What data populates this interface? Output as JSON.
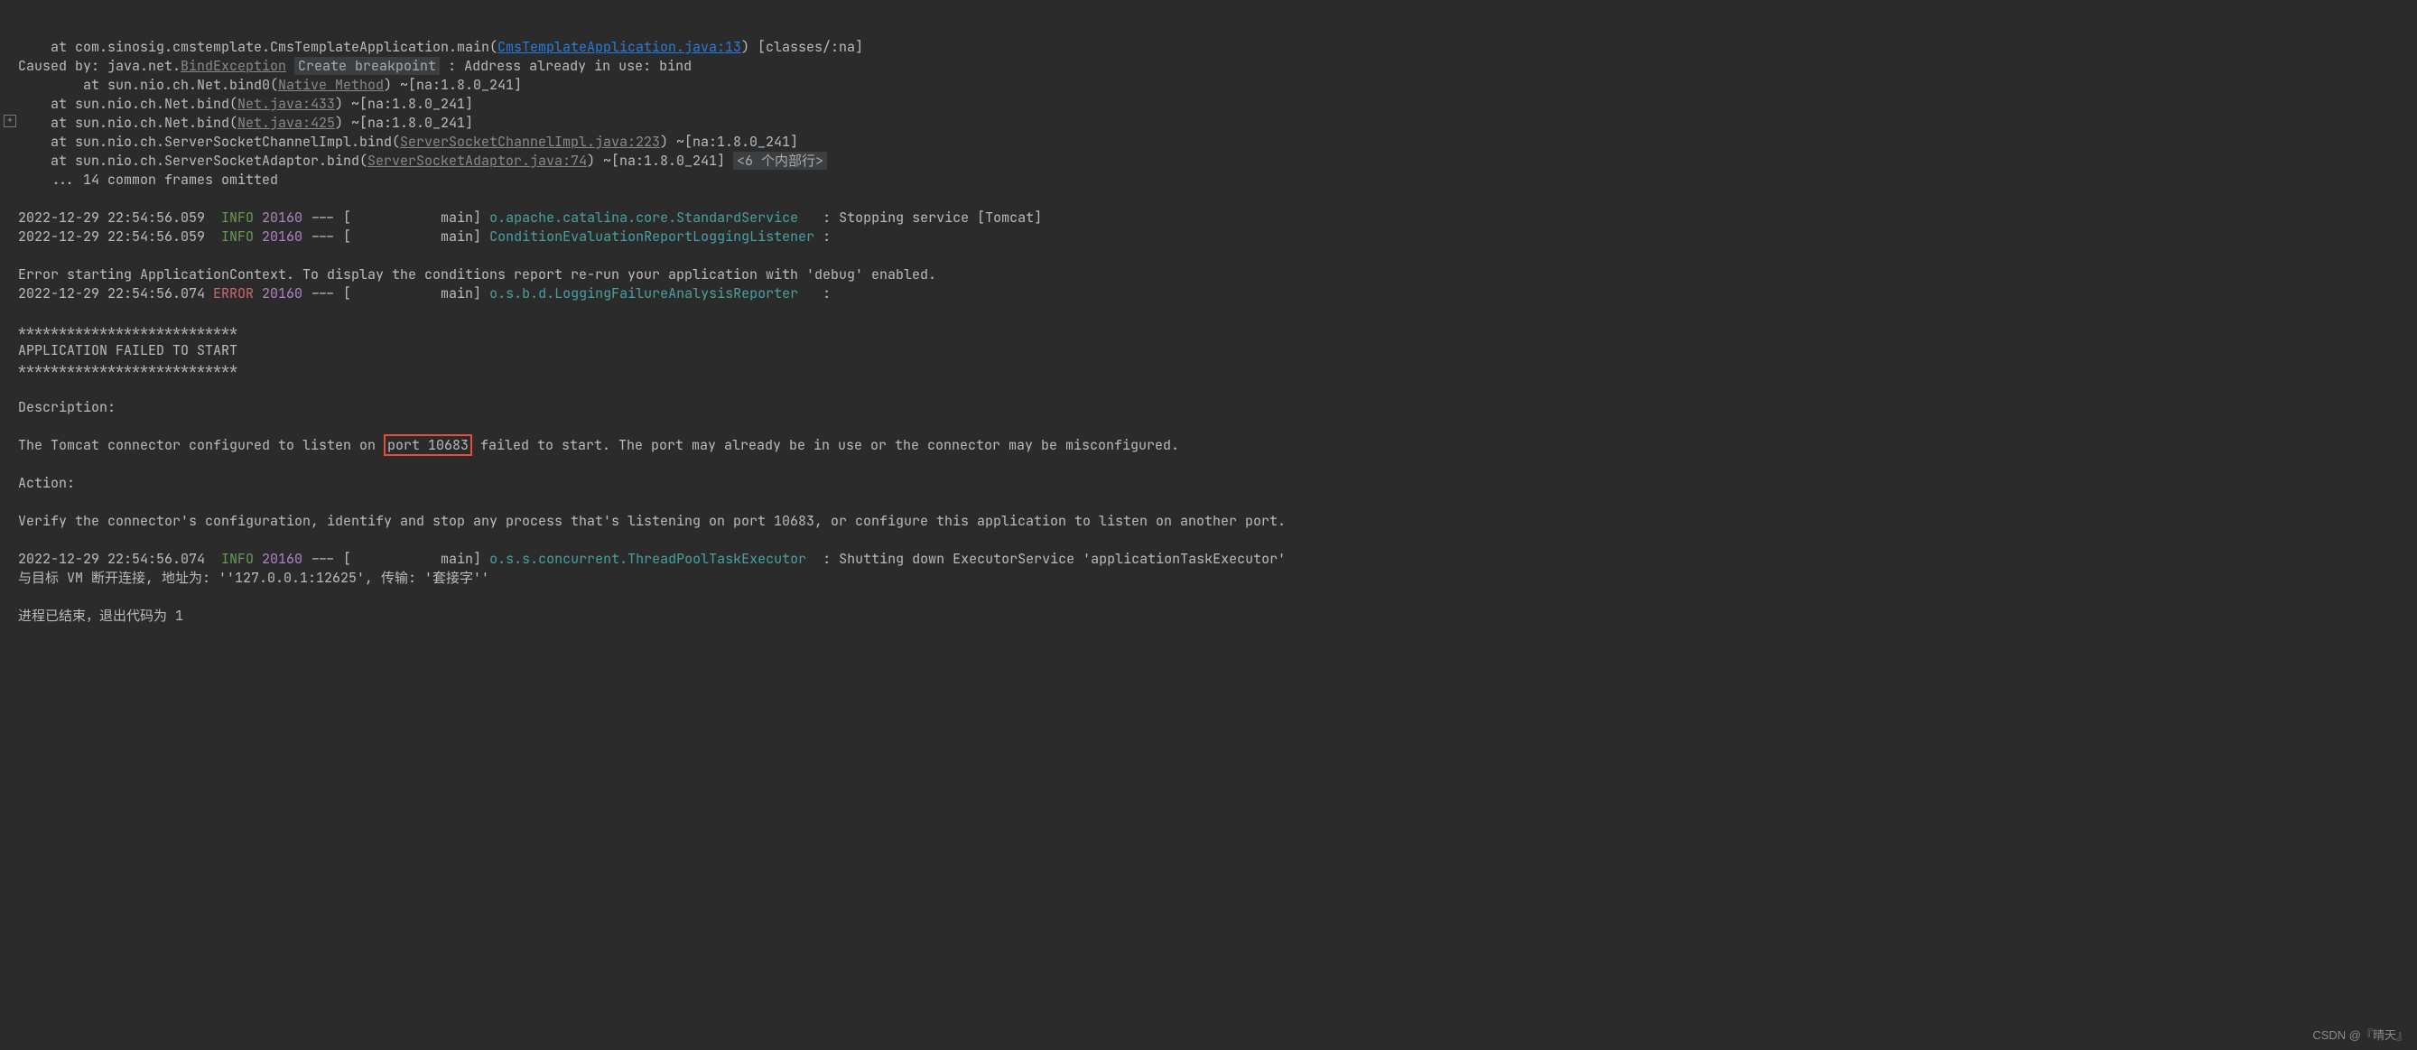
{
  "stack": {
    "line1_pre": "    at com.sinosig.cmstemplate.CmsTemplateApplication.main(",
    "line1_link": "CmsTemplateApplication.java:13",
    "line1_post": ") [classes/:na]",
    "caused_pre": "Caused by: java.net.",
    "caused_ex": "BindException",
    "breakpoint": "Create breakpoint",
    "caused_post": " : Address already in use: bind",
    "l2_pre": "        at sun.nio.ch.Net.bind0(",
    "l2_link": "Native Method",
    "l2_post": ") ~[na:1.8.0_241]",
    "l3_pre": "    at sun.nio.ch.Net.bind(",
    "l3_link": "Net.java:433",
    "l3_post": ") ~[na:1.8.0_241]",
    "l4_pre": "    at sun.nio.ch.Net.bind(",
    "l4_link": "Net.java:425",
    "l4_post": ") ~[na:1.8.0_241]",
    "l5_pre": "    at sun.nio.ch.ServerSocketChannelImpl.bind(",
    "l5_link": "ServerSocketChannelImpl.java:223",
    "l5_post": ") ~[na:1.8.0_241]",
    "l6_pre": "    at sun.nio.ch.ServerSocketAdaptor.bind(",
    "l6_link": "ServerSocketAdaptor.java:74",
    "l6_post": ") ~[na:1.8.0_241] ",
    "folded": "<6 个内部行>",
    "omitted": "    ... 14 common frames omitted"
  },
  "log": {
    "ts1": "2022-12-29 22:54:56.059  ",
    "info": "INFO",
    "error": "ERROR",
    "pid": " 20160",
    "thread": " --- [           main] ",
    "logger1": "o.apache.catalina.core.StandardService  ",
    "msg1": " : Stopping service [Tomcat]",
    "logger2": "ConditionEvaluationReportLoggingListener",
    "msg2": " : ",
    "ts3": "2022-12-29 22:54:56.074 ",
    "logger3": "o.s.b.d.LoggingFailureAnalysisReporter  ",
    "msg3": " : ",
    "ts4": "2022-12-29 22:54:56.074  ",
    "logger4": "o.s.s.concurrent.ThreadPoolTaskExecutor ",
    "msg4": " : Shutting down ExecutorService 'applicationTaskExecutor'"
  },
  "fail": {
    "errline": "Error starting ApplicationContext. To display the conditions report re-run your application with 'debug' enabled.",
    "stars": "***************************",
    "title": "APPLICATION FAILED TO START",
    "desc_h": "Description:",
    "desc_pre": "The Tomcat connector configured to listen on ",
    "port": "port 10683",
    "desc_post": " failed to start. The port may already be in use or the connector may be misconfigured.",
    "act_h": "Action:",
    "act": "Verify the connector's configuration, identify and stop any process that's listening on port 10683, or configure this application to listen on another port."
  },
  "foot": {
    "disc": "与目标 VM 断开连接, 地址为: ''127.0.0.1:12625', 传输: '套接字''",
    "exit": "进程已结束，退出代码为 1"
  },
  "watermark": "CSDN @『晴天』"
}
